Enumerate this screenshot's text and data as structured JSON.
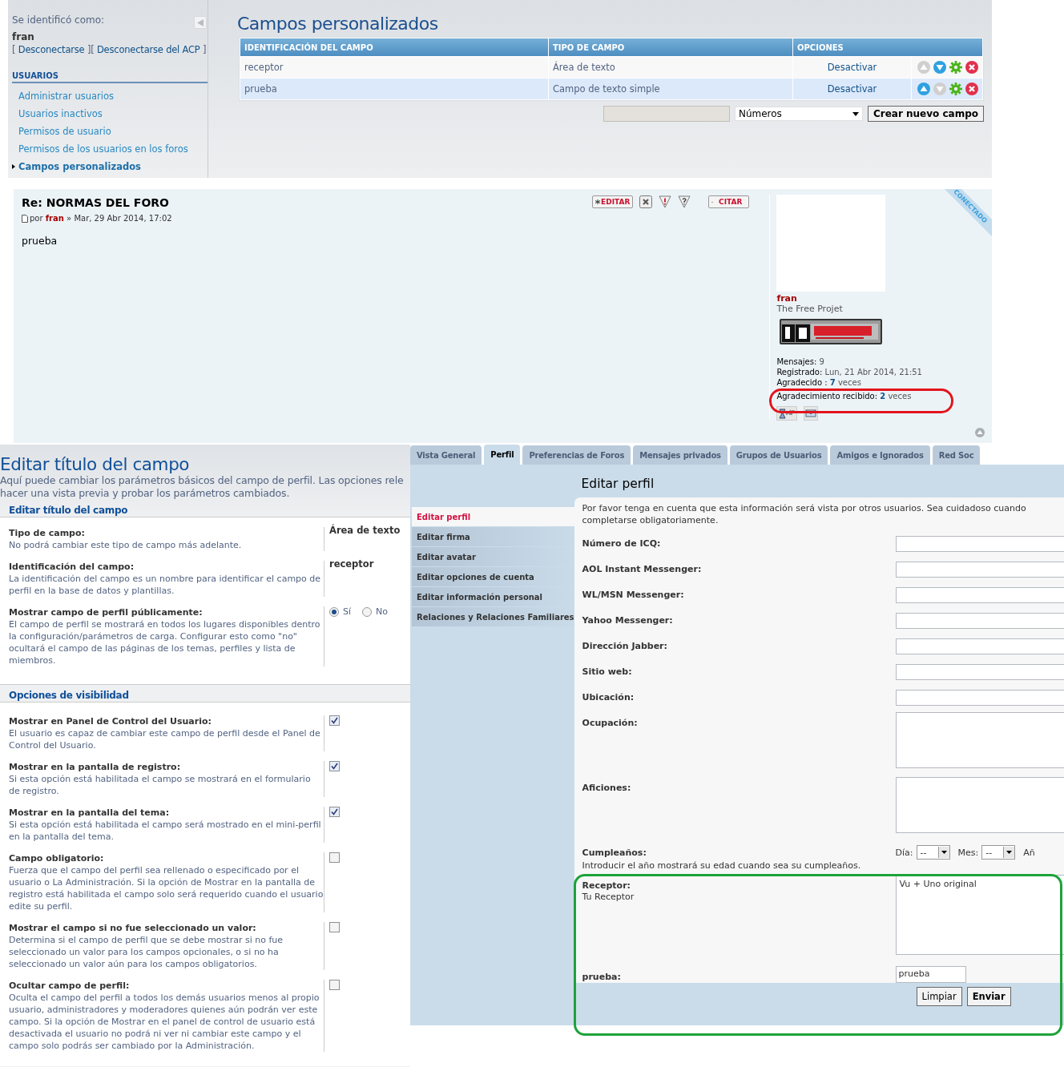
{
  "admin_panel": {
    "login_label": "Se identificó como:",
    "username": "fran",
    "logout_line": {
      "open": "[",
      "links": [
        "Desconectarse",
        "Desconectarse del ACP"
      ],
      "between": "][",
      "close": "]"
    },
    "menu_heading": "USUARIOS",
    "menu": [
      {
        "label": "Administrar usuarios",
        "selected": false
      },
      {
        "label": "Usuarios inactivos",
        "selected": false
      },
      {
        "label": "Permisos de usuario",
        "selected": false
      },
      {
        "label": "Permisos de los usuarios en los foros",
        "selected": false
      },
      {
        "label": "Campos personalizados",
        "selected": true
      }
    ],
    "title": "Campos personalizados",
    "columns": [
      "IDENTIFICACIÓN DEL CAMPO",
      "TIPO DE CAMPO",
      "OPCIONES"
    ],
    "rows": [
      {
        "id": "receptor",
        "type": "Área de texto",
        "action": "Desactivar",
        "move_up_enabled": false,
        "move_down_enabled": true
      },
      {
        "id": "prueba",
        "type": "Campo de texto simple",
        "action": "Desactivar",
        "move_up_enabled": true,
        "move_down_enabled": false
      }
    ],
    "type_select": "Números",
    "create_button": "Crear nuevo campo"
  },
  "post": {
    "title": "Re: NORMAS DEL FORO",
    "by": "por",
    "author": "fran",
    "separator": "»",
    "date": "Mar, 29 Abr 2014, 17:02",
    "body": "prueba",
    "buttons": [
      {
        "kind": "edit",
        "label": "EDITAR"
      },
      {
        "kind": "delete"
      },
      {
        "kind": "report"
      },
      {
        "kind": "info"
      },
      {
        "kind": "quote",
        "label": "CITAR"
      }
    ],
    "status": "CONECTADO",
    "profile": {
      "name": "fran",
      "rank": "The Free Projet",
      "stats": [
        {
          "label": "Mensajes:",
          "value": "9"
        },
        {
          "label": "Registrado:",
          "value": "Lun, 21 Abr 2014, 21:51"
        },
        {
          "label": "Agradecido :",
          "count": "7",
          "unit": "veces"
        },
        {
          "label": "Agradecimiento recibido:",
          "count": "2",
          "unit": "veces"
        }
      ]
    }
  },
  "field_editor": {
    "title": "Editar título del campo",
    "intro": [
      "Aquí puede cambiar los parámetros básicos del campo de perfil. Las opciones rele",
      "hacer una vista previa y probar los parámetros cambiados."
    ],
    "sections": [
      {
        "legend": "Editar título del campo",
        "rows": [
          {
            "kind": "text",
            "label": "Tipo de campo:",
            "help": "No podrá cambiar este tipo de campo más adelante.",
            "value": "Área de texto"
          },
          {
            "kind": "text",
            "label": "Identificación del campo:",
            "help": "La identificación del campo es un nombre para identificar el campo de perfil en la base de datos y plantillas.",
            "value": "receptor"
          },
          {
            "kind": "radio",
            "label": "Mostrar campo de perfil públicamente:",
            "help": "El campo de perfil se mostrará en todos los lugares disponibles dentro la configuración/parámetros de carga. Configurar esto como \"no\" ocultará el campo de las páginas de los temas, perfiles y lista de miembros.",
            "options": [
              {
                "label": "Sí",
                "selected": true
              },
              {
                "label": "No",
                "selected": false
              }
            ]
          }
        ]
      },
      {
        "legend": "Opciones de visibilidad",
        "rows": [
          {
            "kind": "checkbox",
            "label": "Mostrar en Panel de Control del Usuario:",
            "help": "El usuario es capaz de cambiar este campo de perfil desde el Panel de Control del Usuario.",
            "checked": true
          },
          {
            "kind": "checkbox",
            "label": "Mostrar en la pantalla de registro:",
            "help": "Si esta opción está habilitada el campo se mostrará en el formulario de registro.",
            "checked": true
          },
          {
            "kind": "checkbox",
            "label": "Mostrar en la pantalla del tema:",
            "help": "Si esta opción está habilitada el campo será mostrado en el mini-perfil en la pantalla del tema.",
            "checked": true
          },
          {
            "kind": "checkbox",
            "label": "Campo obligatorio:",
            "help": "Fuerza que el campo del perfil sea rellenado o especificado por el usuario o La Administración. Si la opción de Mostrar en la pantalla de registro está habilitada el campo solo será requerido cuando el usuario edite su perfil.",
            "checked": false
          },
          {
            "kind": "checkbox",
            "label": "Mostrar el campo si no fue seleccionado un valor:",
            "help": "Determina si el campo de perfil que se debe mostrar si no fue seleccionado un valor para los campos opcionales, o si no ha seleccionado un valor aún para los campos obligatorios.",
            "checked": false
          },
          {
            "kind": "checkbox",
            "label": "Ocultar campo de perfil:",
            "help": "Oculta el campo del perfil a todos los demás usuarios menos al propio usuario, administradores y moderadores quienes aún podrán ver este campo. Si la opción de Mostrar en el panel de control de usuario está desactivada el usuario no podrá ni ver ni cambiar este campo y el campo solo podrás ser cambiado por la Administración.",
            "checked": false
          }
        ]
      }
    ]
  },
  "profile_editor": {
    "tabs": [
      {
        "label": "Vista General",
        "selected": false
      },
      {
        "label": "Perfil",
        "selected": true
      },
      {
        "label": "Preferencias de Foros",
        "selected": false
      },
      {
        "label": "Mensajes privados",
        "selected": false
      },
      {
        "label": "Grupos de Usuarios",
        "selected": false
      },
      {
        "label": "Amigos e Ignorados",
        "selected": false
      },
      {
        "label": "Red Soc",
        "selected": false
      }
    ],
    "menu": [
      {
        "label": "Editar perfil",
        "selected": true
      },
      {
        "label": "Editar firma",
        "selected": false
      },
      {
        "label": "Editar avatar",
        "selected": false
      },
      {
        "label": "Editar opciones de cuenta",
        "selected": false
      },
      {
        "label": "Editar información personal",
        "selected": false
      },
      {
        "label": "Relaciones y Relaciones Familiares",
        "selected": false
      }
    ],
    "title": "Editar perfil",
    "notice": [
      "Por favor tenga en cuenta que esta información será vista por otros usuarios. Sea cuidadoso cuando",
      "completarse obligatoriamente."
    ],
    "fields": [
      {
        "kind": "input",
        "label": "Número de ICQ:"
      },
      {
        "kind": "input",
        "label": "AOL Instant Messenger:"
      },
      {
        "kind": "input",
        "label": "WL/MSN Messenger:"
      },
      {
        "kind": "input",
        "label": "Yahoo Messenger:"
      },
      {
        "kind": "input",
        "label": "Dirección Jabber:"
      },
      {
        "kind": "input",
        "label": "Sitio web:"
      },
      {
        "kind": "input",
        "label": "Ubicación:"
      },
      {
        "kind": "textarea",
        "label": "Ocupación:"
      },
      {
        "kind": "textarea",
        "label": "Aficiones:"
      },
      {
        "kind": "birthday",
        "label": "Cumpleaños:",
        "parts": [
          {
            "label": "Día:",
            "value": "--"
          },
          {
            "label": "Mes:",
            "value": "--"
          },
          {
            "label": "Añ"
          }
        ],
        "hint": "Introducir el año mostrará su edad cuando sea su cumpleaños."
      },
      {
        "kind": "tall_textarea",
        "label": "Receptor:",
        "help": "Tu Receptor",
        "value": "Vu + Uno original"
      },
      {
        "kind": "short_input",
        "label": "prueba:",
        "value": "prueba"
      }
    ],
    "buttons": [
      {
        "kind": "reset",
        "label": "Limpiar"
      },
      {
        "kind": "submit",
        "label": "Enviar"
      }
    ]
  },
  "annotations": [
    {
      "kind": "ellipse",
      "color": "#e3141c"
    },
    {
      "kind": "rounded_rect",
      "color": "#1da33a"
    }
  ]
}
